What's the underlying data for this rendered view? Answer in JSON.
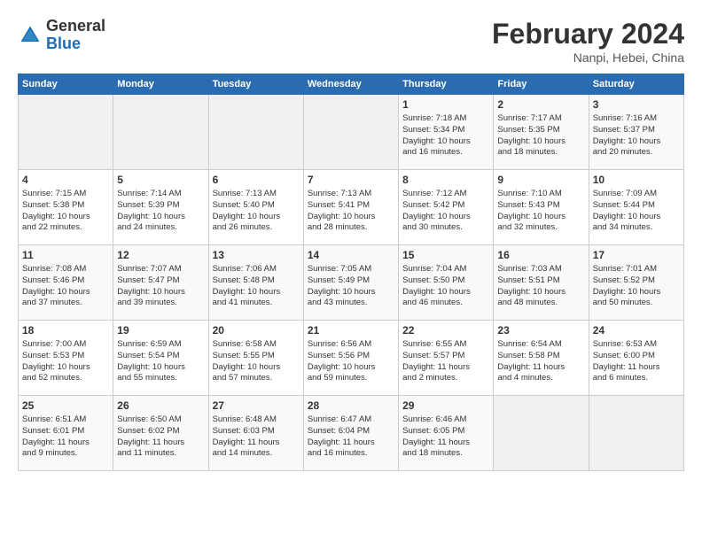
{
  "header": {
    "logo_general": "General",
    "logo_blue": "Blue",
    "month_title": "February 2024",
    "location": "Nanpi, Hebei, China"
  },
  "columns": [
    "Sunday",
    "Monday",
    "Tuesday",
    "Wednesday",
    "Thursday",
    "Friday",
    "Saturday"
  ],
  "weeks": [
    [
      {
        "day": "",
        "info": ""
      },
      {
        "day": "",
        "info": ""
      },
      {
        "day": "",
        "info": ""
      },
      {
        "day": "",
        "info": ""
      },
      {
        "day": "1",
        "info": "Sunrise: 7:18 AM\nSunset: 5:34 PM\nDaylight: 10 hours\nand 16 minutes."
      },
      {
        "day": "2",
        "info": "Sunrise: 7:17 AM\nSunset: 5:35 PM\nDaylight: 10 hours\nand 18 minutes."
      },
      {
        "day": "3",
        "info": "Sunrise: 7:16 AM\nSunset: 5:37 PM\nDaylight: 10 hours\nand 20 minutes."
      }
    ],
    [
      {
        "day": "4",
        "info": "Sunrise: 7:15 AM\nSunset: 5:38 PM\nDaylight: 10 hours\nand 22 minutes."
      },
      {
        "day": "5",
        "info": "Sunrise: 7:14 AM\nSunset: 5:39 PM\nDaylight: 10 hours\nand 24 minutes."
      },
      {
        "day": "6",
        "info": "Sunrise: 7:13 AM\nSunset: 5:40 PM\nDaylight: 10 hours\nand 26 minutes."
      },
      {
        "day": "7",
        "info": "Sunrise: 7:13 AM\nSunset: 5:41 PM\nDaylight: 10 hours\nand 28 minutes."
      },
      {
        "day": "8",
        "info": "Sunrise: 7:12 AM\nSunset: 5:42 PM\nDaylight: 10 hours\nand 30 minutes."
      },
      {
        "day": "9",
        "info": "Sunrise: 7:10 AM\nSunset: 5:43 PM\nDaylight: 10 hours\nand 32 minutes."
      },
      {
        "day": "10",
        "info": "Sunrise: 7:09 AM\nSunset: 5:44 PM\nDaylight: 10 hours\nand 34 minutes."
      }
    ],
    [
      {
        "day": "11",
        "info": "Sunrise: 7:08 AM\nSunset: 5:46 PM\nDaylight: 10 hours\nand 37 minutes."
      },
      {
        "day": "12",
        "info": "Sunrise: 7:07 AM\nSunset: 5:47 PM\nDaylight: 10 hours\nand 39 minutes."
      },
      {
        "day": "13",
        "info": "Sunrise: 7:06 AM\nSunset: 5:48 PM\nDaylight: 10 hours\nand 41 minutes."
      },
      {
        "day": "14",
        "info": "Sunrise: 7:05 AM\nSunset: 5:49 PM\nDaylight: 10 hours\nand 43 minutes."
      },
      {
        "day": "15",
        "info": "Sunrise: 7:04 AM\nSunset: 5:50 PM\nDaylight: 10 hours\nand 46 minutes."
      },
      {
        "day": "16",
        "info": "Sunrise: 7:03 AM\nSunset: 5:51 PM\nDaylight: 10 hours\nand 48 minutes."
      },
      {
        "day": "17",
        "info": "Sunrise: 7:01 AM\nSunset: 5:52 PM\nDaylight: 10 hours\nand 50 minutes."
      }
    ],
    [
      {
        "day": "18",
        "info": "Sunrise: 7:00 AM\nSunset: 5:53 PM\nDaylight: 10 hours\nand 52 minutes."
      },
      {
        "day": "19",
        "info": "Sunrise: 6:59 AM\nSunset: 5:54 PM\nDaylight: 10 hours\nand 55 minutes."
      },
      {
        "day": "20",
        "info": "Sunrise: 6:58 AM\nSunset: 5:55 PM\nDaylight: 10 hours\nand 57 minutes."
      },
      {
        "day": "21",
        "info": "Sunrise: 6:56 AM\nSunset: 5:56 PM\nDaylight: 10 hours\nand 59 minutes."
      },
      {
        "day": "22",
        "info": "Sunrise: 6:55 AM\nSunset: 5:57 PM\nDaylight: 11 hours\nand 2 minutes."
      },
      {
        "day": "23",
        "info": "Sunrise: 6:54 AM\nSunset: 5:58 PM\nDaylight: 11 hours\nand 4 minutes."
      },
      {
        "day": "24",
        "info": "Sunrise: 6:53 AM\nSunset: 6:00 PM\nDaylight: 11 hours\nand 6 minutes."
      }
    ],
    [
      {
        "day": "25",
        "info": "Sunrise: 6:51 AM\nSunset: 6:01 PM\nDaylight: 11 hours\nand 9 minutes."
      },
      {
        "day": "26",
        "info": "Sunrise: 6:50 AM\nSunset: 6:02 PM\nDaylight: 11 hours\nand 11 minutes."
      },
      {
        "day": "27",
        "info": "Sunrise: 6:48 AM\nSunset: 6:03 PM\nDaylight: 11 hours\nand 14 minutes."
      },
      {
        "day": "28",
        "info": "Sunrise: 6:47 AM\nSunset: 6:04 PM\nDaylight: 11 hours\nand 16 minutes."
      },
      {
        "day": "29",
        "info": "Sunrise: 6:46 AM\nSunset: 6:05 PM\nDaylight: 11 hours\nand 18 minutes."
      },
      {
        "day": "",
        "info": ""
      },
      {
        "day": "",
        "info": ""
      }
    ]
  ]
}
